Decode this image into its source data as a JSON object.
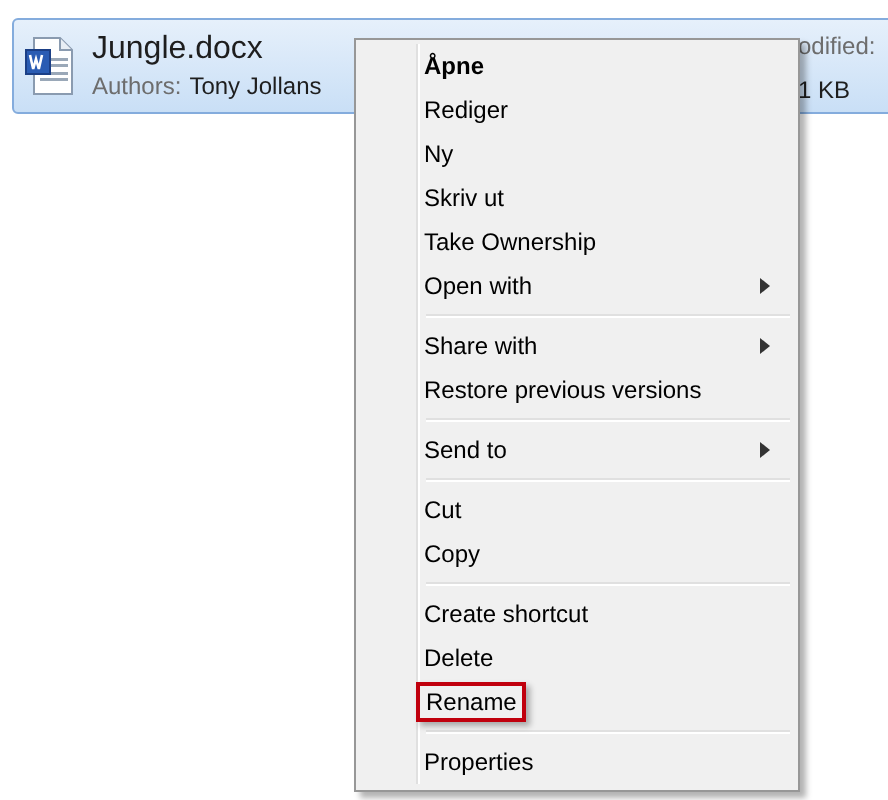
{
  "file": {
    "name": "Jungle.docx",
    "authors_label": "Authors:",
    "authors": "Tony Jollans",
    "selected": true,
    "column_3": "odified:",
    "size": "1 KB"
  },
  "context_menu": [
    {
      "kind": "item",
      "label": "Åpne",
      "default": true
    },
    {
      "kind": "item",
      "label": "Rediger"
    },
    {
      "kind": "item",
      "label": "Ny"
    },
    {
      "kind": "item",
      "label": "Skriv ut"
    },
    {
      "kind": "item",
      "label": "Take Ownership"
    },
    {
      "kind": "item",
      "label": "Open with",
      "submenu": true
    },
    {
      "kind": "separator"
    },
    {
      "kind": "item",
      "label": "Share with",
      "submenu": true
    },
    {
      "kind": "item",
      "label": "Restore previous versions"
    },
    {
      "kind": "separator"
    },
    {
      "kind": "item",
      "label": "Send to",
      "submenu": true
    },
    {
      "kind": "separator"
    },
    {
      "kind": "item",
      "label": "Cut"
    },
    {
      "kind": "item",
      "label": "Copy"
    },
    {
      "kind": "separator"
    },
    {
      "kind": "item",
      "label": "Create shortcut"
    },
    {
      "kind": "item",
      "label": "Delete"
    },
    {
      "kind": "item",
      "label": "Rename",
      "outlined": true
    },
    {
      "kind": "separator"
    },
    {
      "kind": "item",
      "label": "Properties"
    }
  ]
}
